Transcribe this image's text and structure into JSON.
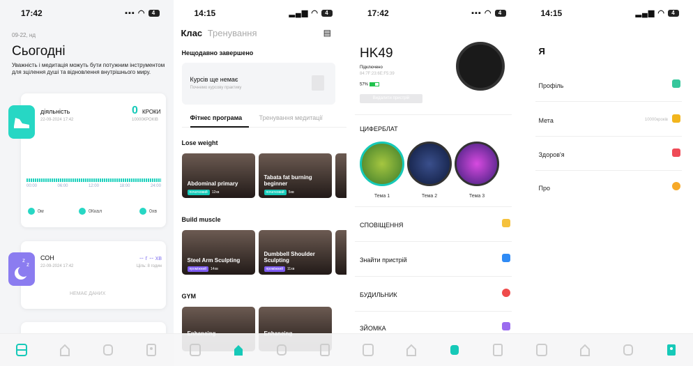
{
  "colors": {
    "accent": "#27d7c4",
    "sleep": "#8b7cf0",
    "active_tab": "#16c9b8"
  },
  "panel1": {
    "time": "17:42",
    "date": "09-22, нд",
    "title": "Сьогодні",
    "desc": "Уважність і медитація можуть бути потужним інструментом для зцілення душі та відновлення внутрішнього миру.",
    "activity": {
      "label": "діяльність",
      "ts": "22-09-2024 17:42",
      "value": "0",
      "unit": "КРОКИ",
      "goal": "10000КРОКІВ",
      "ticks": [
        "00:00",
        "06:00",
        "12:00",
        "18:00",
        "24:00"
      ],
      "stats": [
        {
          "icon": "distance-icon",
          "text": "0м"
        },
        {
          "icon": "calorie-icon",
          "text": "0Ккал"
        },
        {
          "icon": "clock-icon",
          "text": "0хв"
        }
      ]
    },
    "sleep": {
      "label": "СОН",
      "ts": "22-09-2024 17:42",
      "value": "-- г -- хв",
      "goal": "Ціль: 8 годин",
      "empty": "НЕМАЄ ДАНИХ"
    }
  },
  "panel2": {
    "time": "14:15",
    "tab_active": "Клас",
    "tab_inactive": "Тренування",
    "recent": "Нещодавно завершено",
    "empty_title": "Курсів ще немає",
    "empty_sub": "Почнемо курсову практику",
    "sub_active": "Фітнес програма",
    "sub_inactive": "Тренування медитації",
    "sections": [
      {
        "title": "Lose weight",
        "items": [
          {
            "name": "Abdominal primary",
            "level": "початковий",
            "dur": "12хв"
          },
          {
            "name": "Tabata fat burning beginner",
            "level": "початковий",
            "dur": "5хв"
          }
        ]
      },
      {
        "title": "Build muscle",
        "items": [
          {
            "name": "Steel Arm Sculpting",
            "level": "проміжний",
            "dur": "14хв"
          },
          {
            "name": "Dumbbell Shoulder Sculpting",
            "level": "проміжний",
            "dur": "11хв"
          }
        ]
      },
      {
        "title": "GYM",
        "items": [
          {
            "name": "Enhancing",
            "level": "",
            "dur": ""
          },
          {
            "name": "Enhancing",
            "level": "",
            "dur": ""
          }
        ]
      }
    ]
  },
  "panel3": {
    "time": "17:42",
    "device": "HK49",
    "status": "Підключено",
    "mac": "84:7F:23:6E:F5:39",
    "battery": "57%",
    "unbind": "Видалити пристрій",
    "faces_title": "ЦИФЕРБЛАТ",
    "faces": [
      "Тема 1",
      "Тема 2",
      "Тема 3"
    ],
    "rows": [
      {
        "label": "СПОВІЩЕННЯ",
        "icon": "message-icon",
        "color": "#f5c13c"
      },
      {
        "label": "Знайти пристрій",
        "icon": "search-icon",
        "color": "#2f8bf5"
      },
      {
        "label": "БУДИЛЬНИК",
        "icon": "alarm-icon",
        "color": "#ef4b4b"
      },
      {
        "label": "ЗЙОМКА",
        "icon": "camera-icon",
        "color": "#9a6bef"
      }
    ]
  },
  "panel4": {
    "time": "14:15",
    "title": "Я",
    "rows": [
      {
        "label": "Профіль",
        "value": "",
        "icon": "profile-icon",
        "color": "#36c79c"
      },
      {
        "label": "Мета",
        "value": "10000кроків",
        "icon": "trophy-icon",
        "color": "#f2b51d"
      },
      {
        "label": "Здоров'я",
        "value": "",
        "icon": "heart-icon",
        "color": "#ef4b57"
      },
      {
        "label": "Про",
        "value": "",
        "icon": "info-icon",
        "color": "#f7a928"
      }
    ]
  }
}
